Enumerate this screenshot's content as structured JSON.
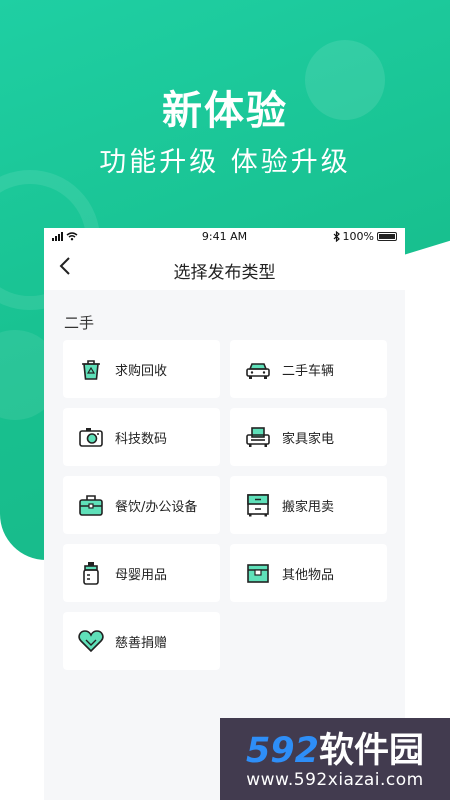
{
  "promo": {
    "headline": "新体验",
    "subheadline": "功能升级 体验升级"
  },
  "status_bar": {
    "time": "9:41 AM",
    "battery": "100%",
    "signal": "▂▄▆",
    "wifi": "wifi",
    "bluetooth": "bluetooth"
  },
  "nav": {
    "back_icon": "‹",
    "title": "选择发布类型"
  },
  "section": {
    "title": "二手"
  },
  "categories": [
    {
      "label": "求购回收",
      "icon": "recycle-bin-icon"
    },
    {
      "label": "二手车辆",
      "icon": "car-icon"
    },
    {
      "label": "科技数码",
      "icon": "camera-icon"
    },
    {
      "label": "家具家电",
      "icon": "sofa-icon"
    },
    {
      "label": "餐饮/办公设备",
      "icon": "briefcase-icon"
    },
    {
      "label": "搬家甩卖",
      "icon": "cabinet-icon"
    },
    {
      "label": "母婴用品",
      "icon": "baby-bottle-icon"
    },
    {
      "label": "其他物品",
      "icon": "box-icon"
    },
    {
      "label": "慈善捐赠",
      "icon": "heart-icon"
    }
  ],
  "colors": {
    "accent": "#1ec89a",
    "icon_fill": "#5fe0b9",
    "stroke": "#222222"
  },
  "watermark": {
    "number": "592",
    "brand": "软件园",
    "url": "www.592xiazai.com"
  }
}
